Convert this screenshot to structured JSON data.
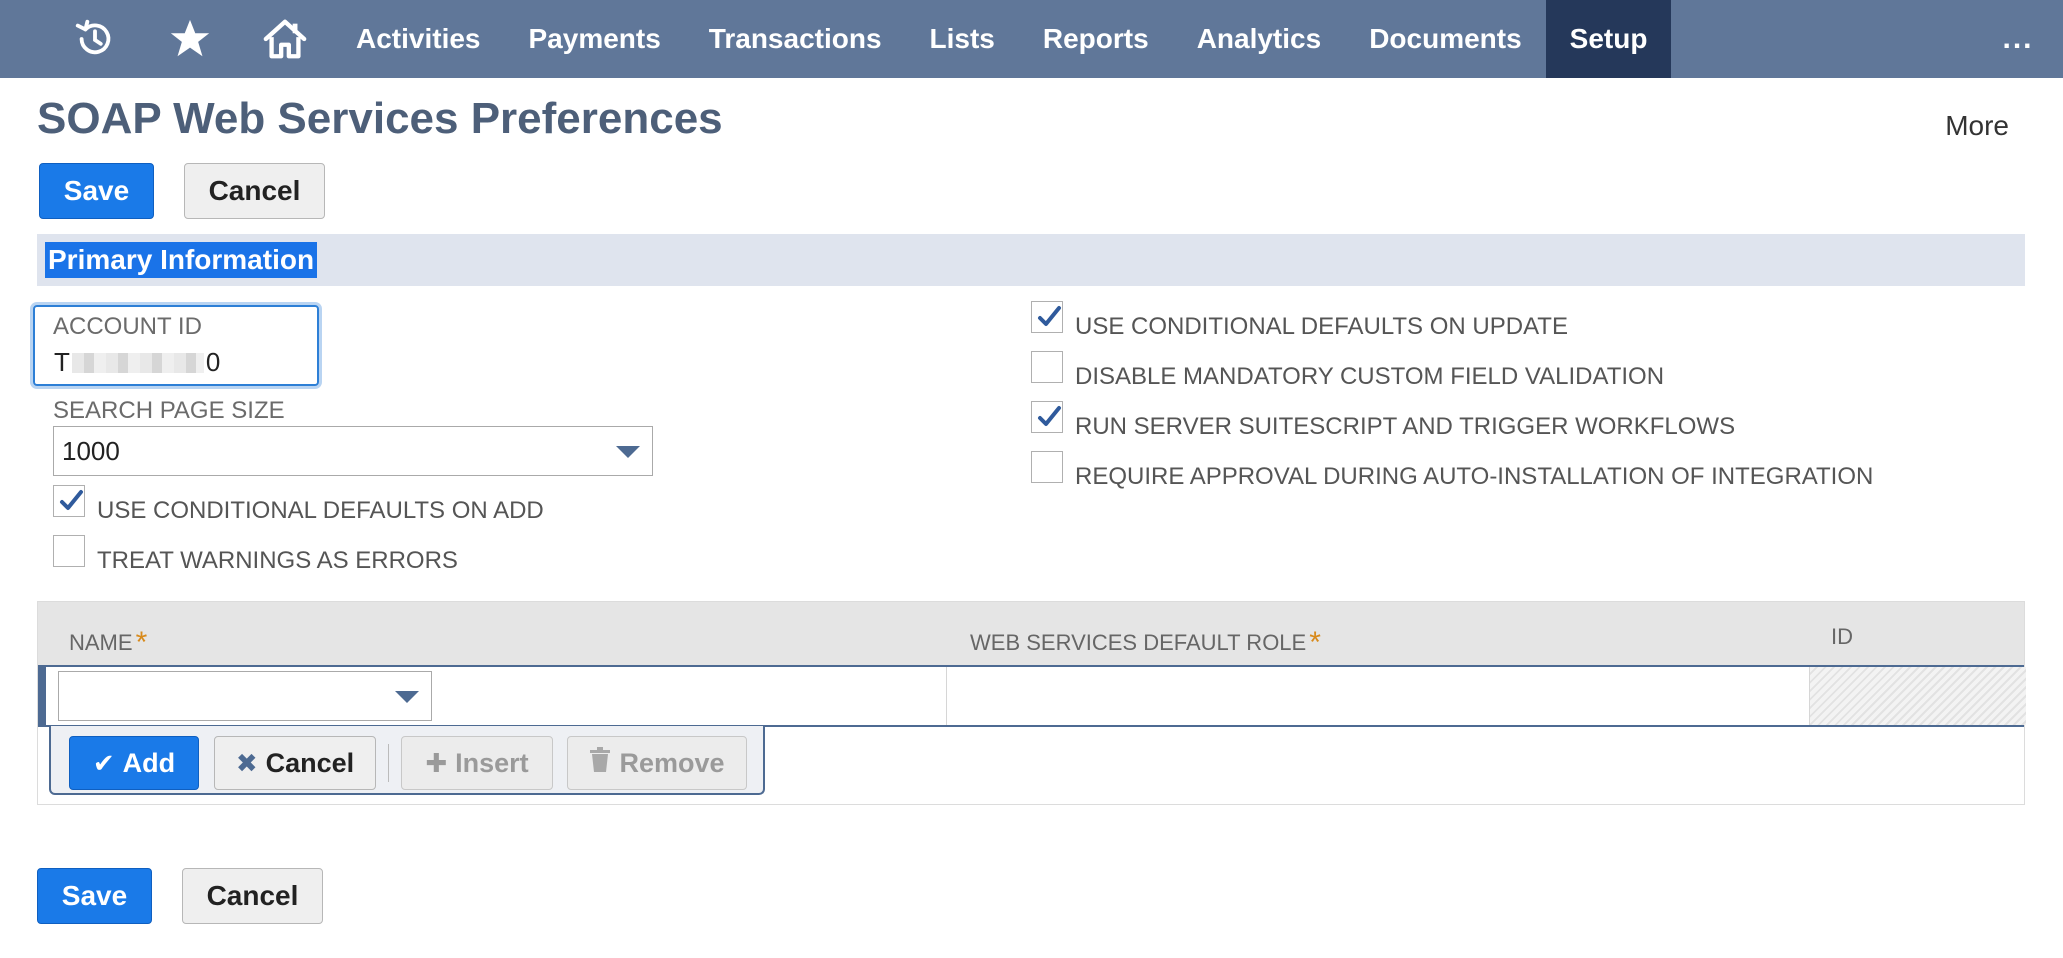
{
  "nav": {
    "icons": [
      "recent-history-icon",
      "star-icon",
      "home-icon"
    ],
    "items": [
      {
        "label": "Activities",
        "active": false
      },
      {
        "label": "Payments",
        "active": false
      },
      {
        "label": "Transactions",
        "active": false
      },
      {
        "label": "Lists",
        "active": false
      },
      {
        "label": "Reports",
        "active": false
      },
      {
        "label": "Analytics",
        "active": false
      },
      {
        "label": "Documents",
        "active": false
      },
      {
        "label": "Setup",
        "active": true
      }
    ],
    "overflow_label": "...",
    "bar_color": "#607799",
    "active_color": "#25385a"
  },
  "header": {
    "title": "SOAP Web Services Preferences",
    "more_label": "More"
  },
  "top_buttons": {
    "save": "Save",
    "cancel": "Cancel"
  },
  "bottom_buttons": {
    "save": "Save",
    "cancel": "Cancel"
  },
  "section": {
    "title": "Primary Information"
  },
  "form": {
    "account_id": {
      "label": "ACCOUNT ID",
      "value_start": "T",
      "value_end": "0"
    },
    "search_page_size": {
      "label": "SEARCH PAGE SIZE",
      "value": "1000"
    },
    "left_checkboxes": [
      {
        "label": "USE CONDITIONAL DEFAULTS ON ADD",
        "checked": true
      },
      {
        "label": "TREAT WARNINGS AS ERRORS",
        "checked": false
      }
    ],
    "right_checkboxes": [
      {
        "label": "USE CONDITIONAL DEFAULTS ON UPDATE",
        "checked": true
      },
      {
        "label": "DISABLE MANDATORY CUSTOM FIELD VALIDATION",
        "checked": false
      },
      {
        "label": "RUN SERVER SUITESCRIPT AND TRIGGER WORKFLOWS",
        "checked": true
      },
      {
        "label": "REQUIRE APPROVAL DURING AUTO-INSTALLATION OF INTEGRATION",
        "checked": false
      }
    ]
  },
  "sublist": {
    "columns": {
      "name": "NAME",
      "role": "WEB SERVICES DEFAULT ROLE",
      "id": "ID"
    },
    "required_mark": "*",
    "name_value": "",
    "actions": {
      "add": "Add",
      "cancel": "Cancel",
      "insert": "Insert",
      "remove": "Remove"
    }
  },
  "colors": {
    "primary": "#1a7ae8",
    "title": "#4d5f79",
    "section_bg": "#dfe4ee",
    "required": "#d88a1b"
  }
}
